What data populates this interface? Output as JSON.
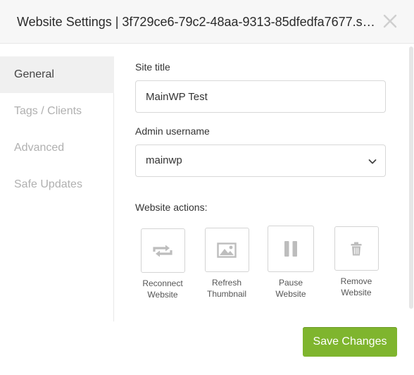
{
  "modal": {
    "title": "Website Settings | 3f729ce6-79c2-48aa-9313-85dfedfa7677.s1...",
    "close_icon": "close-icon"
  },
  "sidebar": {
    "items": [
      {
        "label": "General",
        "active": true
      },
      {
        "label": "Tags / Clients",
        "active": false
      },
      {
        "label": "Advanced",
        "active": false
      },
      {
        "label": "Safe Updates",
        "active": false
      }
    ]
  },
  "form": {
    "site_title": {
      "label": "Site title",
      "value": "MainWP Test"
    },
    "admin_username": {
      "label": "Admin username",
      "value": "mainwp"
    },
    "actions_label": "Website actions:",
    "actions": [
      {
        "label": "Reconnect\nWebsite",
        "icon": "reconnect-icon"
      },
      {
        "label": "Refresh\nThumbnail",
        "icon": "image-icon"
      },
      {
        "label": "Pause\nWebsite",
        "icon": "pause-icon"
      },
      {
        "label": "Remove\nWebsite",
        "icon": "trash-icon"
      }
    ]
  },
  "footer": {
    "save_label": "Save Changes"
  },
  "colors": {
    "accent": "#7fb52e",
    "icon_gray": "#bdbdbd",
    "sidebar_active_bg": "#f0f0f0"
  }
}
